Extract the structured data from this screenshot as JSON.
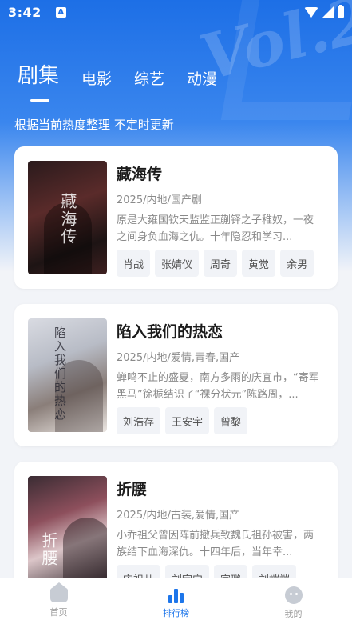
{
  "status": {
    "time": "3:42",
    "notif_badge": "A"
  },
  "tabs": [
    {
      "label": "剧集",
      "active": true
    },
    {
      "label": "电影",
      "active": false
    },
    {
      "label": "综艺",
      "active": false
    },
    {
      "label": "动漫",
      "active": false
    }
  ],
  "subtitle": "根据当前热度整理 不定时更新",
  "cards": [
    {
      "title": "藏海传",
      "meta": "2025/内地/国产剧",
      "desc": "原是大雍国钦天监监正蒯铎之子稚奴，一夜之间身负血海之仇。十年隐忍和学习...",
      "poster_text": "藏海传",
      "cast": [
        "肖战",
        "张婧仪",
        "周奇",
        "黄觉",
        "余男"
      ]
    },
    {
      "title": "陷入我们的热恋",
      "meta": "2025/内地/爱情,青春,国产",
      "desc": "蝉鸣不止的盛夏，南方多雨的庆宜市，“寄军黑马”徐栀结识了“裸分状元”陈路周，...",
      "poster_text": "陷入我们的热恋",
      "cast": [
        "刘浩存",
        "王安宇",
        "曾黎"
      ]
    },
    {
      "title": "折腰",
      "meta": "2025/内地/古装,爱情,国产",
      "desc": "小乔祖父曾因阵前撤兵致魏氏祖孙被害，两族结下血海深仇。十四年后，当年幸...",
      "poster_text": "折腰",
      "cast": [
        "宋祖儿",
        "刘宇宁",
        "宣璐",
        "刘端端"
      ]
    }
  ],
  "nav": [
    {
      "label": "首页",
      "icon": "home-icon",
      "active": false
    },
    {
      "label": "排行榜",
      "icon": "rank-icon",
      "active": true
    },
    {
      "label": "我的",
      "icon": "me-icon",
      "active": false
    }
  ],
  "colors": {
    "accent": "#1e76ea",
    "hero": "#1d6fe6"
  }
}
